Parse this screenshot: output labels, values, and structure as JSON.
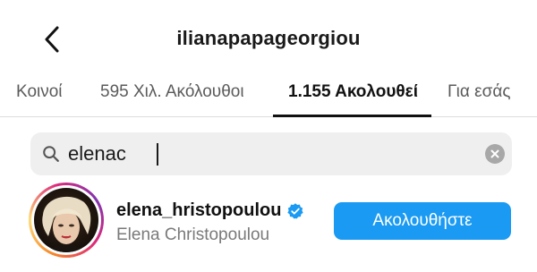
{
  "header": {
    "title": "ilianapapageorgiou",
    "back_icon": "chevron-left-icon"
  },
  "tabs": [
    {
      "label": "Κοινοί",
      "active": false
    },
    {
      "label": "595 Χιλ. Ακόλουθοι",
      "active": false
    },
    {
      "label": "1.155 Ακολουθεί",
      "active": true
    },
    {
      "label": "Για εσάς",
      "active": false
    }
  ],
  "search": {
    "value": "elenac",
    "icon": "search-icon",
    "clear_icon": "clear-icon"
  },
  "results": [
    {
      "username": "elena_hristopoulou",
      "full_name": "Elena Christopoulou",
      "verified": true,
      "button_label": "Ακολουθήστε",
      "button_color": "#1a9af2"
    }
  ],
  "colors": {
    "accent": "#1a9af2",
    "verified": "#1a9af2"
  }
}
